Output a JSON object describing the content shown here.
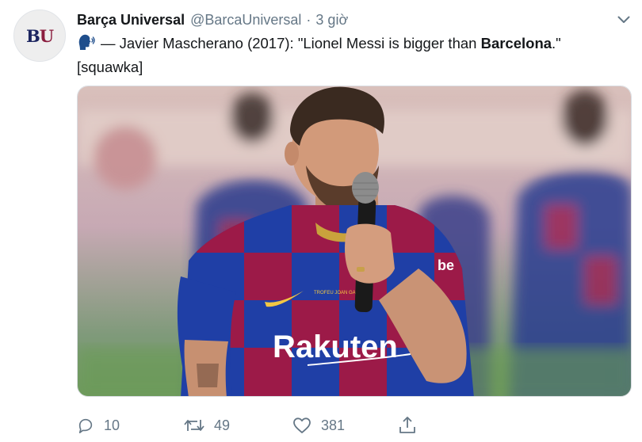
{
  "tweet": {
    "author_name": "Barça Universal",
    "author_handle": "@BarcaUniversal",
    "separator": "·",
    "timestamp": "3 giờ",
    "avatar_text_b": "B",
    "avatar_text_u": "U",
    "text_prefix": "— Javier Mascherano (2017): \"Lionel Messi is bigger than ",
    "text_bold": "Barcelona",
    "text_suffix": ".\"",
    "text_line2": "[squawka]",
    "speaking_icon": "speaking-head-icon",
    "menu_icon": "chevron-down-icon"
  },
  "media": {
    "shirt_sponsor": "Rakuten",
    "shirt_badge_text": "TROFEU JOAN GAMPER",
    "sleeve_text": "be"
  },
  "actions": {
    "reply": {
      "icon": "reply-icon",
      "count": "10"
    },
    "retweet": {
      "icon": "retweet-icon",
      "count": "49"
    },
    "like": {
      "icon": "heart-icon",
      "count": "381"
    },
    "share": {
      "icon": "share-icon"
    }
  },
  "colors": {
    "text": "#14171a",
    "muted": "#657786",
    "barca_blue": "#1d3fa8",
    "barca_red": "#a3174a",
    "barca_navy": "#1c2560"
  }
}
